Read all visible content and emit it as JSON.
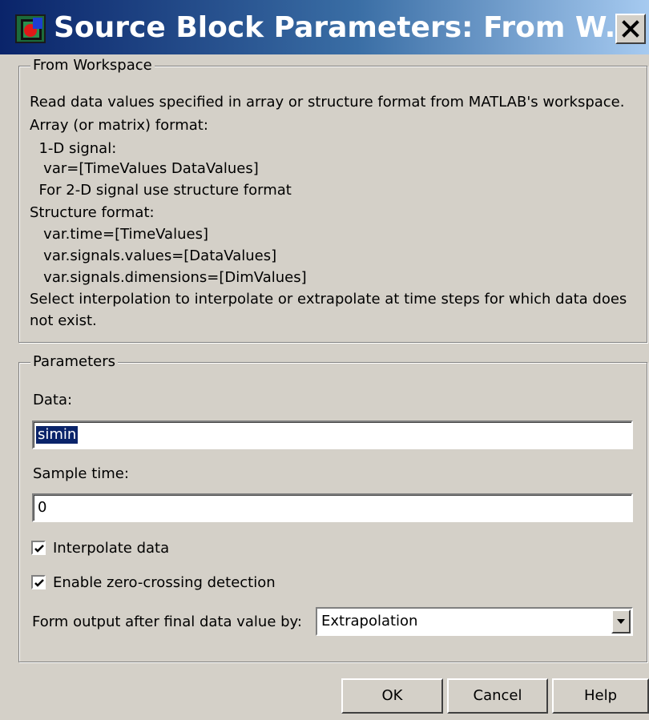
{
  "window": {
    "title": "Source Block Parameters: From W...",
    "close_glyph": "✕"
  },
  "workspace_group": {
    "legend": "From Workspace",
    "lines": [
      "Read data values specified in array or structure format from MATLAB's workspace.",
      "Array (or matrix) format:",
      "  1-D signal:",
      "   var=[TimeValues DataValues]",
      "  For 2-D signal use structure format",
      "Structure format:",
      "   var.time=[TimeValues]",
      "   var.signals.values=[DataValues]",
      "   var.signals.dimensions=[DimValues]",
      "Select interpolation to interpolate or extrapolate at time steps for which data does",
      "not exist."
    ]
  },
  "parameters_group": {
    "legend": "Parameters",
    "data_label": "Data:",
    "data_value": "simin",
    "sample_time_label": "Sample time:",
    "sample_time_value": "0",
    "interpolate_label": "Interpolate data",
    "interpolate_checked": true,
    "zero_crossing_label": "Enable zero-crossing detection",
    "zero_crossing_checked": true,
    "form_output_label": "Form output after final data value by:",
    "form_output_value": "Extrapolation"
  },
  "buttons": {
    "ok": "OK",
    "cancel": "Cancel",
    "help": "Help"
  },
  "icons": {
    "app": "simulink-block-icon",
    "close": "close-icon",
    "check": "checkmark-icon",
    "dropdown": "chevron-down-icon"
  },
  "colors": {
    "titlebar_start": "#0a246a",
    "titlebar_end": "#a6caf0",
    "dialog_bg": "#d4d0c8",
    "selection_bg": "#0a246a"
  }
}
